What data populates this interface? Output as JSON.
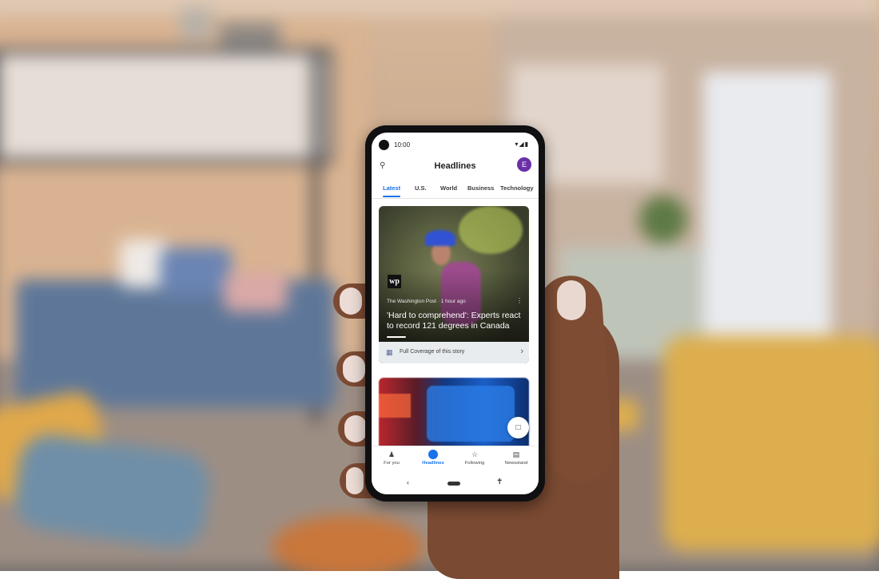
{
  "status_bar": {
    "time": "10:00",
    "icons": "▾◢▮"
  },
  "app_bar": {
    "title": "Headlines",
    "avatar_initial": "E",
    "search_icon": "search-icon"
  },
  "tabs": [
    "Latest",
    "U.S.",
    "World",
    "Business",
    "Technology"
  ],
  "active_tab": "Latest",
  "story": {
    "publisher_logo": "wp",
    "meta": "The Washington Post · 1 hour ago",
    "headline": "'Hard to comprehend': Experts react to record 121 degrees in Canada",
    "full_coverage": "Full Coverage of this story"
  },
  "bottom_nav": [
    {
      "label": "For you",
      "icon": "person-icon"
    },
    {
      "label": "Headlines",
      "icon": "globe-icon"
    },
    {
      "label": "Following",
      "icon": "star-icon"
    },
    {
      "label": "Newsstand",
      "icon": "newsstand-icon"
    }
  ],
  "active_nav": "Headlines",
  "colors": {
    "accent": "#1a73e8",
    "avatar": "#6b2fa8"
  }
}
